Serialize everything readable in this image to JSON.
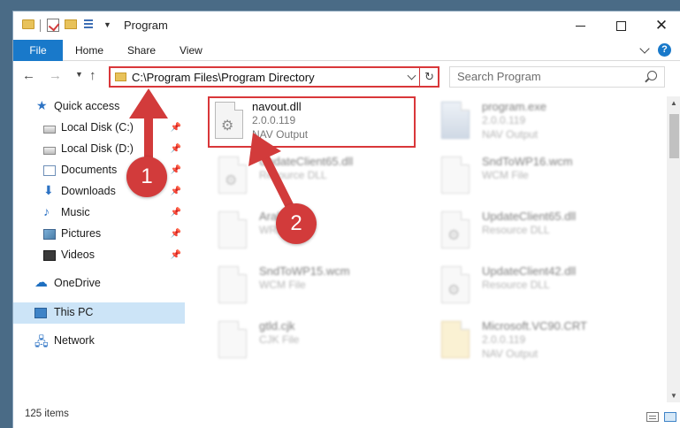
{
  "window": {
    "title": "Program"
  },
  "ribbon": {
    "tabs": [
      "File",
      "Home",
      "Share",
      "View"
    ],
    "help": "?"
  },
  "nav": {
    "address": "C:\\Program Files\\Program Directory",
    "search_placeholder": "Search Program"
  },
  "sidebar": {
    "items": [
      {
        "label": "Quick access",
        "icon": "star-icon",
        "pinned": false
      },
      {
        "label": "Local Disk (C:)",
        "icon": "drive-icon",
        "pinned": true
      },
      {
        "label": "Local Disk (D:)",
        "icon": "drive-icon",
        "pinned": true
      },
      {
        "label": "Documents",
        "icon": "documents-icon",
        "pinned": true
      },
      {
        "label": "Downloads",
        "icon": "download-icon",
        "pinned": true
      },
      {
        "label": "Music",
        "icon": "music-icon",
        "pinned": true
      },
      {
        "label": "Pictures",
        "icon": "pictures-icon",
        "pinned": true
      },
      {
        "label": "Videos",
        "icon": "videos-icon",
        "pinned": true
      },
      {
        "label": "OneDrive",
        "icon": "cloud-icon",
        "pinned": false
      },
      {
        "label": "This PC",
        "icon": "computer-icon",
        "pinned": false,
        "selected": true
      },
      {
        "label": "Network",
        "icon": "network-icon",
        "pinned": false
      }
    ]
  },
  "files": [
    {
      "name": "navout.dll",
      "version": "2.0.0.119",
      "desc": "NAV Output",
      "highlight": true
    },
    {
      "name": "program.exe",
      "version": "2.0.0.119",
      "desc": "NAV Output"
    },
    {
      "name": "UpdateClient65.dll",
      "version": "",
      "desc": "Resource DLL"
    },
    {
      "name": "SndToWP16.wcm",
      "version": "",
      "desc": "WCM File"
    },
    {
      "name": "Arabic.wri",
      "version": "",
      "desc": "WRI File"
    },
    {
      "name": "UpdateClient65.dll",
      "version": "",
      "desc": "Resource DLL"
    },
    {
      "name": "SndToWP15.wcm",
      "version": "",
      "desc": "WCM File"
    },
    {
      "name": "UpdateClient42.dll",
      "version": "",
      "desc": "Resource DLL"
    },
    {
      "name": "gtld.cjk",
      "version": "",
      "desc": "CJK File"
    },
    {
      "name": "Microsoft.VC90.CRT",
      "version": "2.0.0.119",
      "desc": "NAV Output"
    }
  ],
  "status": {
    "count": "125 items"
  },
  "annotations": {
    "step1": "1",
    "step2": "2"
  },
  "colors": {
    "accent": "#1979ca",
    "highlight": "#d9373a",
    "selected": "#cce4f7"
  }
}
